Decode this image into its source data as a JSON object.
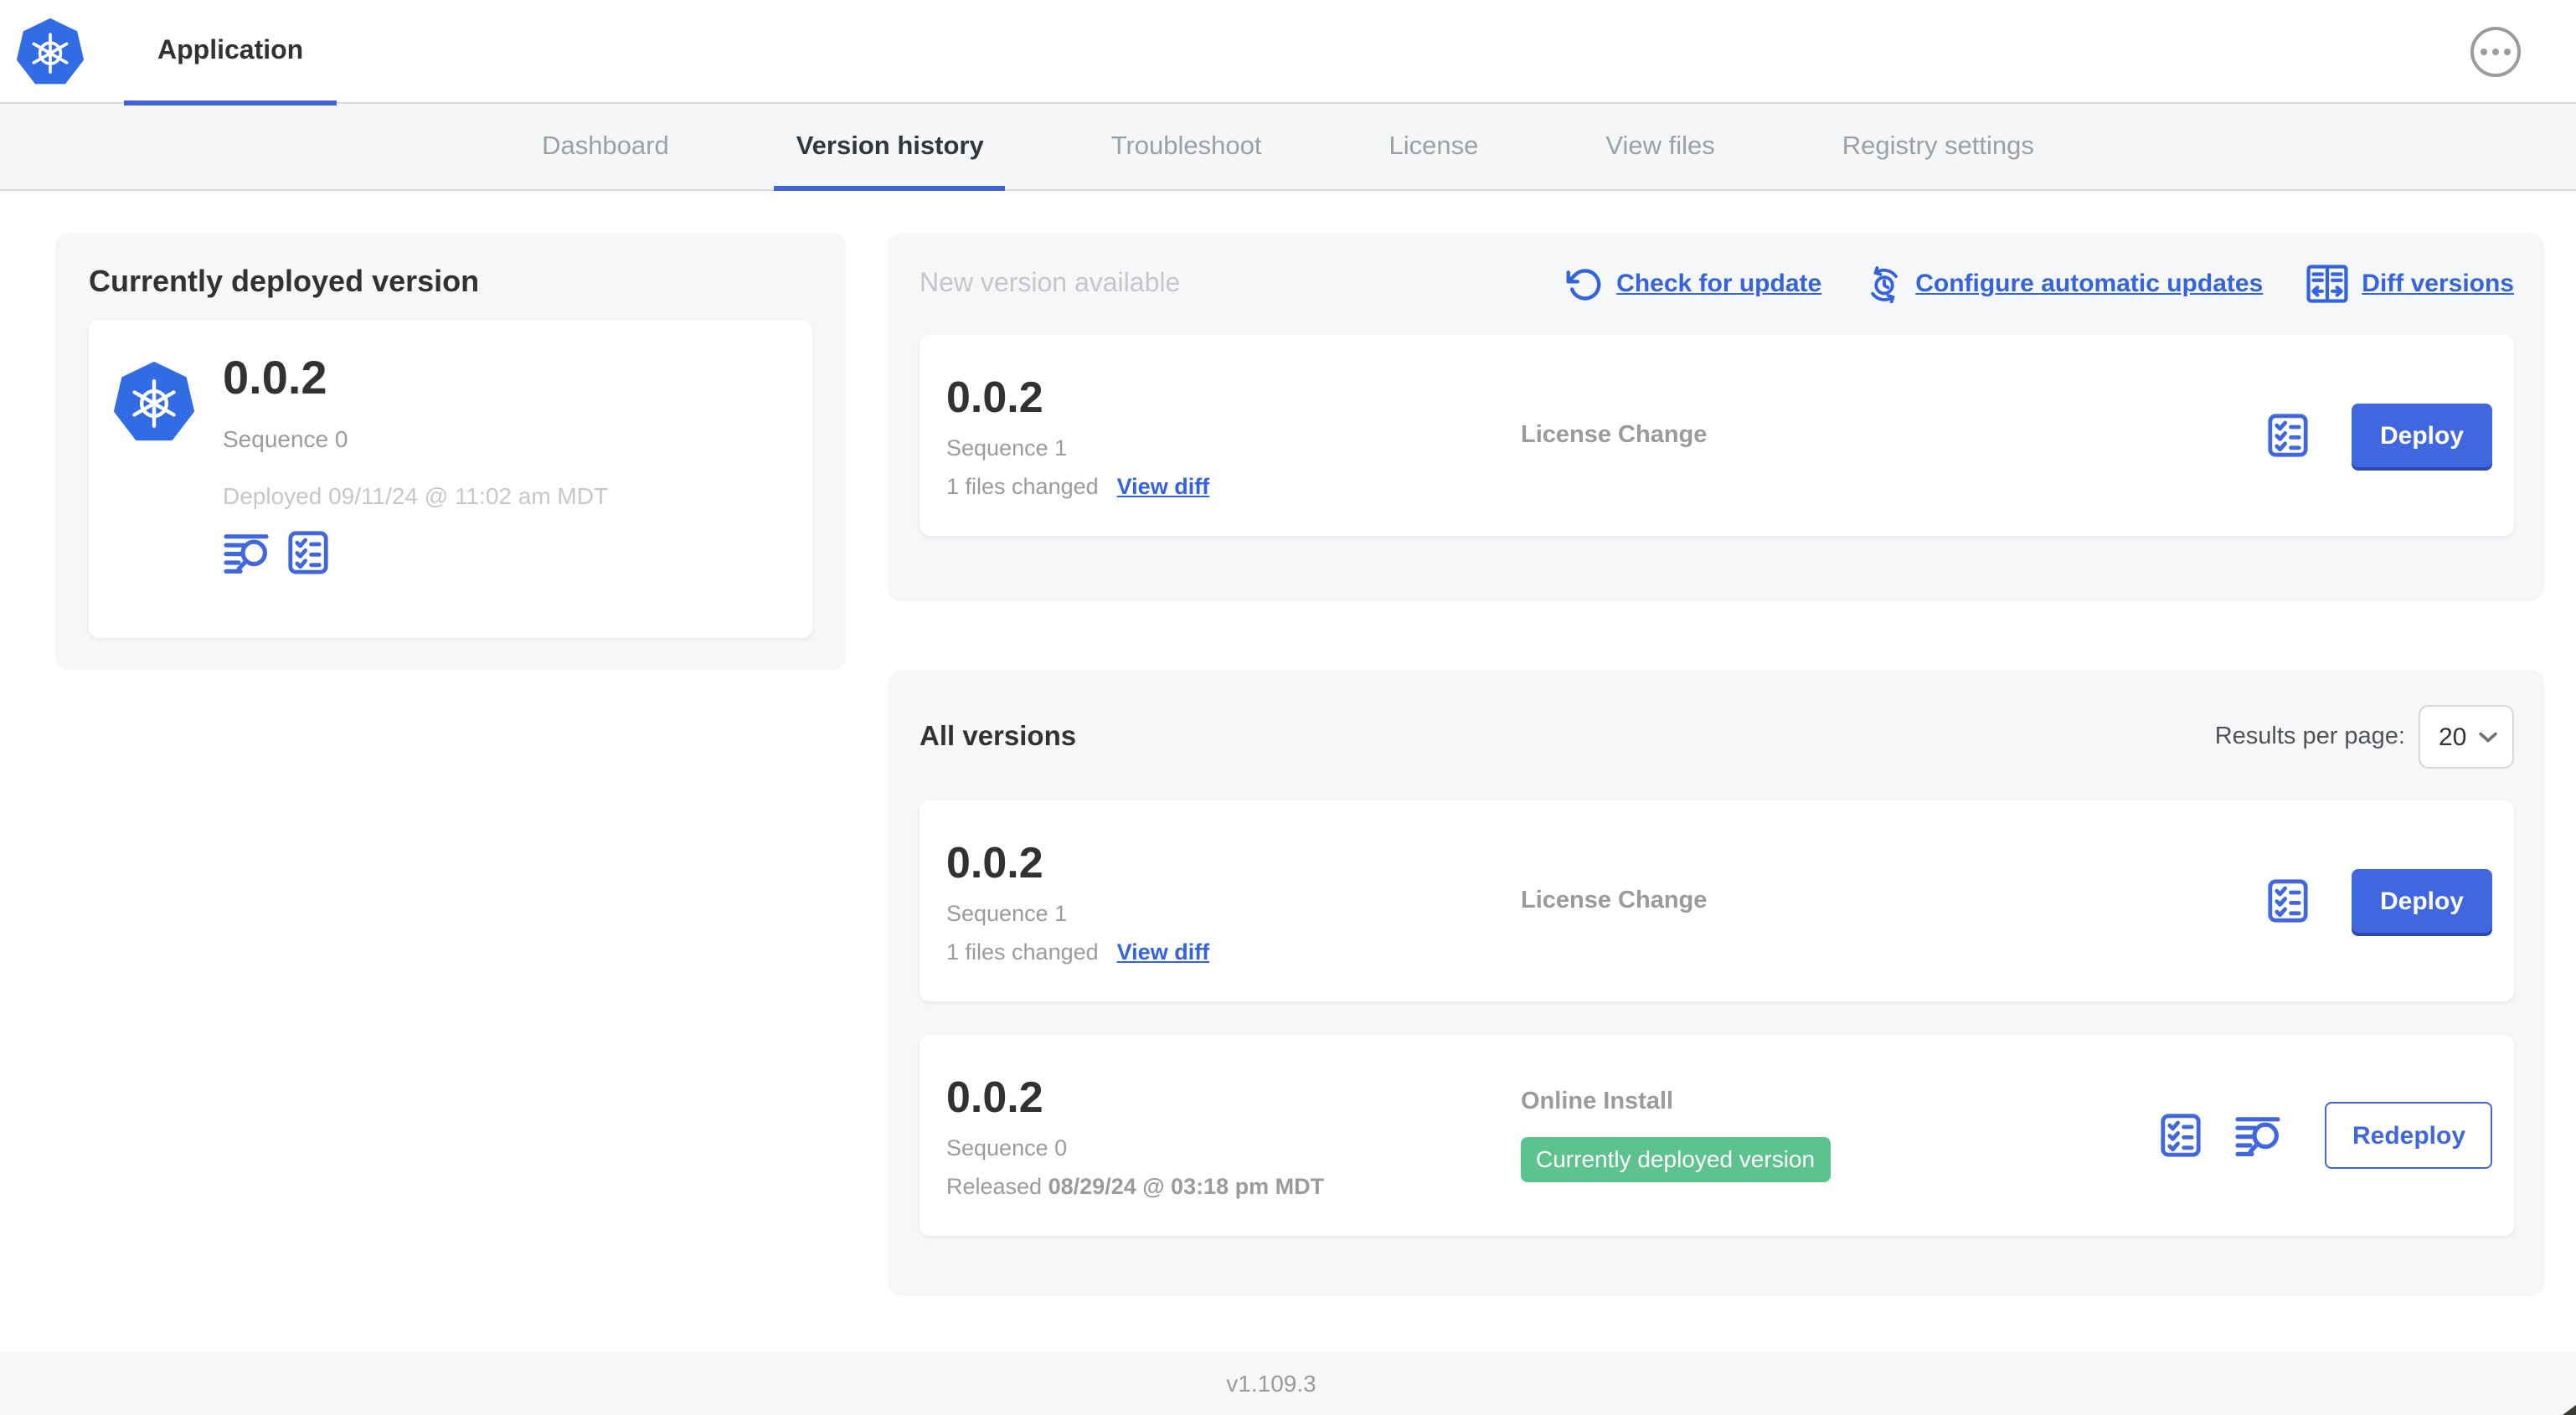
{
  "colors": {
    "accent_blue": "#4067e0",
    "link_blue": "#3563e0",
    "kubernetes_blue": "#326ce5",
    "badge_green": "#5cc38f",
    "panel_gray": "#f5f7f9"
  },
  "icons": {
    "brand": "kubernetes-logo-icon",
    "header_more": "ellipsis-icon",
    "view_logs": "view-logs-icon",
    "preflight_checklist": "checklist-icon",
    "check_update": "refresh-ccw-icon",
    "auto_update": "clock-sync-icon",
    "diff": "diff-columns-icon",
    "select_caret": "chevron-down-icon"
  },
  "header": {
    "app_name": "Application"
  },
  "nav": {
    "active_tab": "Version history",
    "tabs": [
      {
        "label": "Dashboard"
      },
      {
        "label": "Version history"
      },
      {
        "label": "Troubleshoot"
      },
      {
        "label": "License"
      },
      {
        "label": "View files"
      },
      {
        "label": "Registry settings"
      }
    ]
  },
  "current_version_panel": {
    "title": "Currently deployed version",
    "version": "0.0.2",
    "sequence": "Sequence 0",
    "deployed": "Deployed 09/11/24 @ 11:02 am MDT"
  },
  "new_version_panel": {
    "title": "New version available",
    "actions": {
      "check_for_update": "Check for update",
      "configure_automatic_updates": "Configure automatic updates",
      "diff_versions": "Diff versions"
    },
    "row": {
      "version": "0.0.2",
      "sequence": "Sequence 1",
      "files_changed": "1 files changed",
      "view_diff": "View diff",
      "source": "License Change",
      "action_label": "Deploy"
    }
  },
  "all_versions_panel": {
    "title": "All versions",
    "results_per_page_label": "Results per page:",
    "results_per_page_value": "20",
    "rows": [
      {
        "version": "0.0.2",
        "sequence": "Sequence 1",
        "files_changed": "1 files changed",
        "view_diff": "View diff",
        "source": "License Change",
        "action_label": "Deploy"
      },
      {
        "version": "0.0.2",
        "sequence": "Sequence 0",
        "released_label": "Released ",
        "released_date": "08/29/24 @ 03:18 pm MDT",
        "source": "Online Install",
        "badge": "Currently deployed version",
        "action_label": "Redeploy"
      }
    ]
  },
  "footer": {
    "app_version": "v1.109.3"
  }
}
